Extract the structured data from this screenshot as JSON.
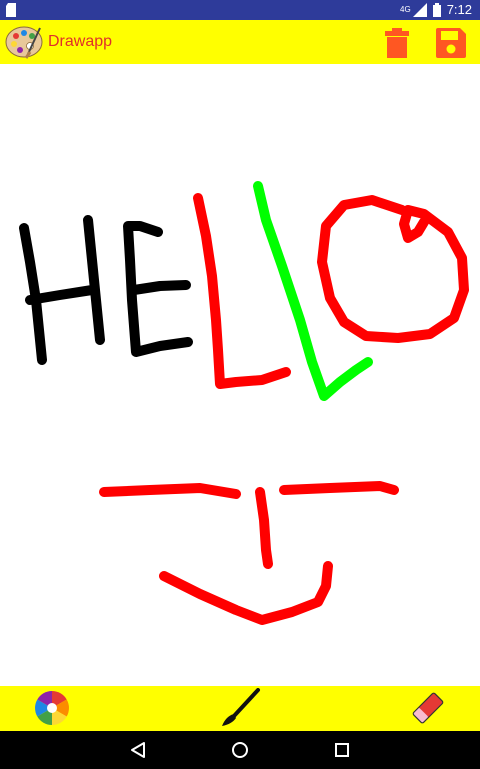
{
  "status_bar": {
    "time": "7:12",
    "network": "4G",
    "icons": [
      "sd-card-icon",
      "signal-icon",
      "battery-icon"
    ]
  },
  "app_bar": {
    "title": "Drawapp",
    "icons": [
      "palette-logo-icon",
      "trash-icon",
      "save-icon"
    ]
  },
  "canvas": {
    "ink_colors": [
      "#000000",
      "#ff0000",
      "#00ff00"
    ]
  },
  "bottom_toolbar": {
    "icons": [
      "color-wheel-icon",
      "brush-icon",
      "eraser-icon"
    ]
  },
  "nav_bar": {
    "icons": [
      "back-icon",
      "home-icon",
      "recents-icon"
    ]
  },
  "colors": {
    "app_bar": "#ffff00",
    "title": "#e0302a",
    "status_bar": "#2e3b9a",
    "nav_bar": "#000000",
    "accent_orange": "#ff5722"
  }
}
